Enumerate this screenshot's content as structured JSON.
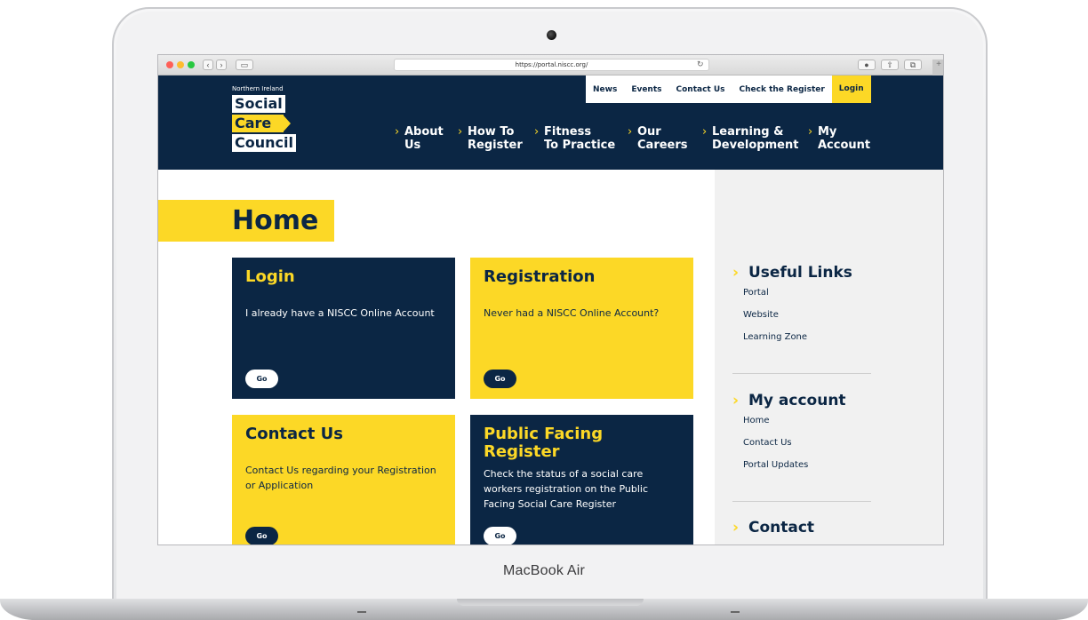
{
  "device": {
    "label": "MacBook Air"
  },
  "browser": {
    "url": "https://portal.niscc.org/"
  },
  "logo": {
    "small": "Northern Ireland",
    "line1": "Social",
    "line2": "Care",
    "line3": "Council"
  },
  "topbar": {
    "news": "News",
    "events": "Events",
    "contact": "Contact Us",
    "check": "Check the Register",
    "login": "Login"
  },
  "nav": {
    "about": {
      "l1": "About",
      "l2": "Us"
    },
    "howto": {
      "l1": "How To",
      "l2": "Register"
    },
    "fitness": {
      "l1": "Fitness",
      "l2": "To Practice"
    },
    "careers": {
      "l1": "Our",
      "l2": "Careers"
    },
    "learning": {
      "l1": "Learning &",
      "l2": "Development"
    },
    "account": {
      "l1": "My",
      "l2": "Account"
    }
  },
  "page": {
    "title": "Home"
  },
  "cards": {
    "login": {
      "title": "Login",
      "desc": "I already have a NISCC Online Account",
      "go": "Go"
    },
    "registration": {
      "title": "Registration",
      "desc": "Never had a NISCC Online Account?",
      "go": "Go"
    },
    "contact": {
      "title": "Contact Us",
      "desc": "Contact Us regarding your Registration or Application",
      "go": "Go"
    },
    "public": {
      "title": "Public Facing Register",
      "desc": "Check the status of a social care workers registration on the Public Facing Social Care Register",
      "go": "Go"
    }
  },
  "sidebar": {
    "useful": {
      "title": "Useful Links",
      "links": [
        "Portal",
        "Website",
        "Learning Zone"
      ]
    },
    "account": {
      "title": "My account",
      "links": [
        "Home",
        "Contact Us",
        "Portal Updates"
      ]
    },
    "contact": {
      "title": "Contact"
    }
  },
  "colors": {
    "navy": "#0b2644",
    "yellow": "#fcd826"
  }
}
